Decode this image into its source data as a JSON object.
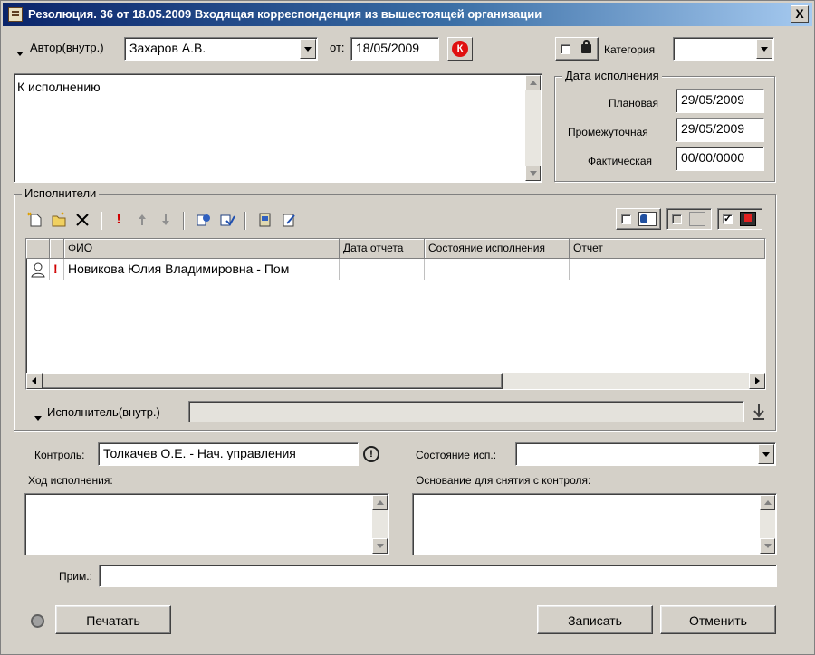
{
  "window": {
    "title": "Резолюция. 36 от 18.05.2009 Входящая корреспонденция из вышестоящей организации",
    "close_label": "X"
  },
  "header": {
    "author_label": "Автор(внутр.)",
    "author_value": "Захаров А.В.",
    "date_label": "от:",
    "date_value": "18/05/2009",
    "control_badge": "К",
    "category_label": "Категория",
    "category_value": ""
  },
  "resolution": {
    "text": "К исполнению"
  },
  "due_dates": {
    "group_title": "Дата исполнения",
    "planned_label": "Плановая",
    "planned_value": "29/05/2009",
    "interim_label": "Промежуточная",
    "interim_value": "29/05/2009",
    "actual_label": "Фактическая",
    "actual_value": "00/00/0000"
  },
  "executors": {
    "group_title": "Исполнители",
    "columns": [
      "ФИО",
      "Дата отчета",
      "Состояние исполнения",
      "Отчет"
    ],
    "rows": [
      {
        "priority": "!",
        "name": "Новикова Юлия Владимировна - Пом",
        "report_date": "",
        "status": "",
        "report": ""
      }
    ],
    "executor_label": "Исполнитель(внутр.)",
    "executor_value": ""
  },
  "control": {
    "control_label": "Контроль:",
    "control_value": "Толкачев О.Е. - Нач. управления",
    "state_label": "Состояние исп.:",
    "state_value": "",
    "progress_label": "Ход исполнения:",
    "progress_value": "",
    "removal_label": "Основание для снятия с контроля:",
    "removal_value": "",
    "note_label": "Прим.:",
    "note_value": ""
  },
  "footer": {
    "print_label": "Печатать",
    "save_label": "Записать",
    "cancel_label": "Отменить"
  },
  "colors": {
    "window_bg": "#d4d0c8",
    "title_start": "#0a246a",
    "title_end": "#a6caf0",
    "priority_red": "#d00000",
    "badge_red": "#e01010"
  }
}
